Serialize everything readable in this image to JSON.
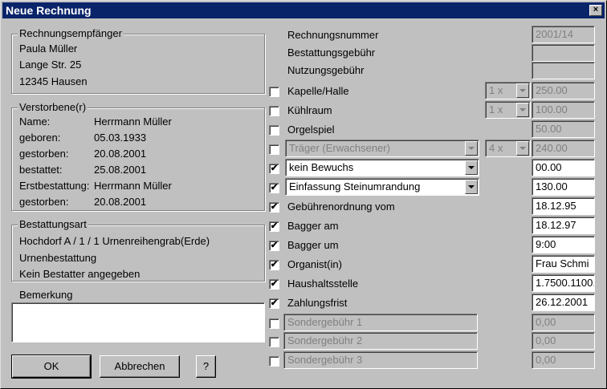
{
  "window": {
    "title": "Neue Rechnung",
    "close": "×"
  },
  "recipient": {
    "legend": "Rechnungsempfänger",
    "name": "Paula Müller",
    "street": "Lange Str. 25",
    "city": "12345  Hausen"
  },
  "deceased": {
    "legend": "Verstorbene(r)",
    "rows": [
      {
        "label": "Name:",
        "value": "Herrmann  Müller"
      },
      {
        "label": "geboren:",
        "value": "05.03.1933"
      },
      {
        "label": "gestorben:",
        "value": "20.08.2001"
      },
      {
        "label": "bestattet:",
        "value": "25.08.2001"
      },
      {
        "label": "Erstbestattung:",
        "value": "Herrmann  Müller"
      },
      {
        "label": "gestorben:",
        "value": "20.08.2001"
      }
    ]
  },
  "burial": {
    "legend": "Bestattungsart",
    "line1": "Hochdorf  A / 1 / 1  Urnenreihengrab(Erde)",
    "line2": "Urnenbestattung",
    "line3": "Kein Bestatter angegeben"
  },
  "remark": {
    "label": "Bemerkung",
    "value": ""
  },
  "buttons": {
    "ok": "OK",
    "cancel": "Abbrechen",
    "help": "?"
  },
  "top_fields": [
    {
      "label": "Rechnungsnummer",
      "value": "2001/14"
    },
    {
      "label": "Bestattungsgebühr",
      "value": ""
    },
    {
      "label": "Nutzungsgebühr",
      "value": ""
    }
  ],
  "items": {
    "kapelle": {
      "label": "Kapelle/Halle",
      "checked": false,
      "qty": "1 x",
      "value": "250.00"
    },
    "kuehlraum": {
      "label": "Kühlraum",
      "checked": false,
      "qty": "1 x",
      "value": "100.00"
    },
    "orgelspiel": {
      "label": "Orgelspiel",
      "checked": false,
      "value": "50.00"
    },
    "traeger": {
      "label": "Träger (Erwachsener)",
      "checked": false,
      "qty": "4 x",
      "value": "240.00"
    },
    "bewuchs": {
      "label": "kein Bewuchs",
      "checked": true,
      "value": "00.00"
    },
    "einfassung": {
      "label": "Einfassung Steinumrandung",
      "checked": true,
      "value": "130.00"
    },
    "gebuehren": {
      "label": "Gebührenordnung vom",
      "checked": true,
      "value": "18.12.95"
    },
    "bagger_am": {
      "label": "Bagger am",
      "checked": true,
      "value": "18.12.97"
    },
    "bagger_um": {
      "label": "Bagger um",
      "checked": true,
      "value": "9:00"
    },
    "organist": {
      "label": "Organist(in)",
      "checked": true,
      "value": "Frau Schmi"
    },
    "haushalt": {
      "label": "Haushaltsstelle",
      "checked": true,
      "value": "1.7500.1100."
    },
    "frist": {
      "label": "Zahlungsfrist",
      "checked": true,
      "value": "26.12.2001"
    },
    "sonder1": {
      "label": "Sondergebühr 1",
      "checked": false,
      "value": "0,00"
    },
    "sonder2": {
      "label": "Sondergebühr 2",
      "checked": false,
      "value": "0,00"
    },
    "sonder3": {
      "label": "Sondergebühr 3",
      "checked": false,
      "value": "0,00"
    }
  },
  "check_mark": "✔",
  "colors": {
    "titlebar": "#0a246a",
    "face": "#c0c0c0",
    "disabled_text": "#808080"
  }
}
